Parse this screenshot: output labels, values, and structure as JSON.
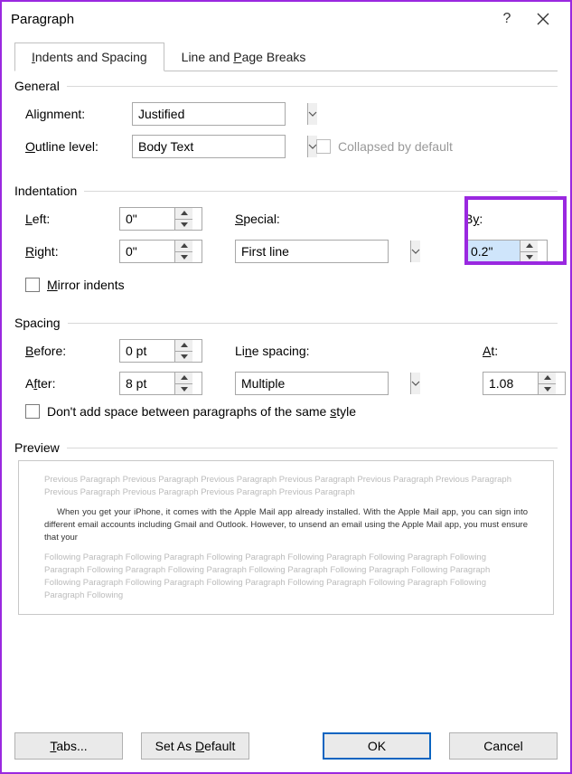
{
  "title": "Paragraph",
  "tabs": {
    "indents": "Indents and Spacing",
    "breaks": "Line and Page Breaks"
  },
  "section": {
    "general": "General",
    "indentation": "Indentation",
    "spacing": "Spacing",
    "preview": "Preview"
  },
  "labels": {
    "alignment": "Alignment:",
    "outline": "Outline level:",
    "collapsed": "Collapsed by default",
    "left": "Left:",
    "right": "Right:",
    "special": "Special:",
    "by": "By:",
    "mirror": "Mirror indents",
    "before": "Before:",
    "after": "After:",
    "linespacing": "Line spacing:",
    "at": "At:",
    "noSpace": "Don't add space between paragraphs of the same style"
  },
  "values": {
    "alignment": "Justified",
    "outline": "Body Text",
    "left": "0\"",
    "right": "0\"",
    "special": "First line",
    "by": "0.2\"",
    "before": "0 pt",
    "after": "8 pt",
    "linespacing": "Multiple",
    "at": "1.08"
  },
  "preview": {
    "prev": "Previous Paragraph Previous Paragraph Previous Paragraph Previous Paragraph Previous Paragraph Previous Paragraph Previous Paragraph Previous Paragraph Previous Paragraph Previous Paragraph",
    "sample": "When you get your iPhone, it comes with the Apple Mail app already installed. With the Apple Mail app, you can sign into different email accounts including Gmail and Outlook. However, to unsend an email using the Apple Mail app, you must ensure that your",
    "next": "Following Paragraph Following Paragraph Following Paragraph Following Paragraph Following Paragraph Following Paragraph Following Paragraph Following Paragraph Following Paragraph Following Paragraph Following Paragraph Following Paragraph Following Paragraph Following Paragraph Following Paragraph Following Paragraph Following Paragraph Following"
  },
  "buttons": {
    "tabs": "Tabs...",
    "default": "Set As Default",
    "ok": "OK",
    "cancel": "Cancel"
  }
}
